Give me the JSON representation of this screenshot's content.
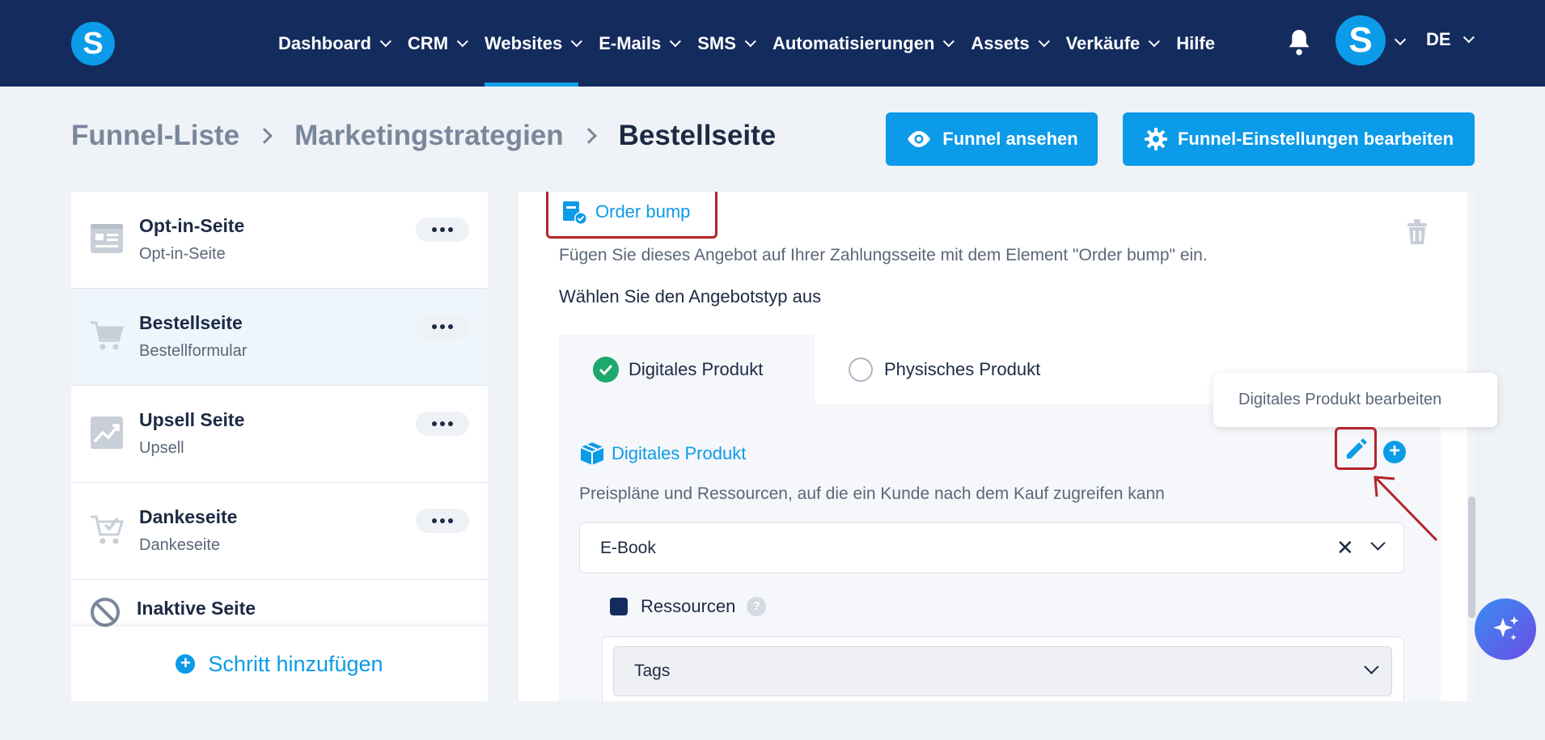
{
  "nav": {
    "logo_letter": "S",
    "items": [
      {
        "label": "Dashboard",
        "dropdown": true,
        "active": false
      },
      {
        "label": "CRM",
        "dropdown": true,
        "active": false
      },
      {
        "label": "Websites",
        "dropdown": true,
        "active": true
      },
      {
        "label": "E-Mails",
        "dropdown": true,
        "active": false
      },
      {
        "label": "SMS",
        "dropdown": true,
        "active": false
      },
      {
        "label": "Automatisierungen",
        "dropdown": true,
        "active": false
      },
      {
        "label": "Assets",
        "dropdown": true,
        "active": false
      },
      {
        "label": "Verkäufe",
        "dropdown": true,
        "active": false
      },
      {
        "label": "Hilfe",
        "dropdown": false,
        "active": false
      }
    ],
    "avatar_letter": "S",
    "language": "DE",
    "icons": {
      "bell": "bell-icon"
    }
  },
  "breadcrumb": {
    "items": [
      "Funnel-Liste",
      "Marketingstrategien",
      "Bestellseite"
    ]
  },
  "actions": {
    "view_funnel": "Funnel ansehen",
    "edit_settings": "Funnel-Einstellungen bearbeiten"
  },
  "steps": {
    "items": [
      {
        "title": "Opt-in-Seite",
        "subtitle": "Opt-in-Seite",
        "icon": "opt-in-page-icon"
      },
      {
        "title": "Bestellseite",
        "subtitle": "Bestellformular",
        "icon": "cart-icon"
      },
      {
        "title": "Upsell Seite",
        "subtitle": "Upsell",
        "icon": "trend-up-icon"
      },
      {
        "title": "Dankeseite",
        "subtitle": "Dankeseite",
        "icon": "cart-check-icon"
      }
    ],
    "inactive_label": "Inaktive Seite",
    "add_step": "Schritt hinzufügen"
  },
  "order_bump": {
    "title": "Order bump",
    "description": "Fügen Sie dieses Angebot auf Ihrer Zahlungsseite mit dem Element \"Order bump\" ein.",
    "choose_label": "Wählen Sie den Angebotstyp aus",
    "tabs": [
      "Digitales Produkt",
      "Physisches Produkt"
    ],
    "selected_tab": "Digitales Produkt",
    "digital": {
      "title": "Digitales Produkt",
      "description": "Preispläne und Ressourcen, auf die ein Kunde nach dem Kauf zugreifen kann",
      "product_value": "E-Book",
      "resources_label": "Ressourcen",
      "help": "?",
      "tags_label": "Tags"
    },
    "tooltip": "Digitales Produkt bearbeiten"
  },
  "colors": {
    "nav_bg": "#142b5e",
    "accent": "#0c9be8",
    "highlight_red": "#b4232a",
    "success": "#1ea86e"
  }
}
